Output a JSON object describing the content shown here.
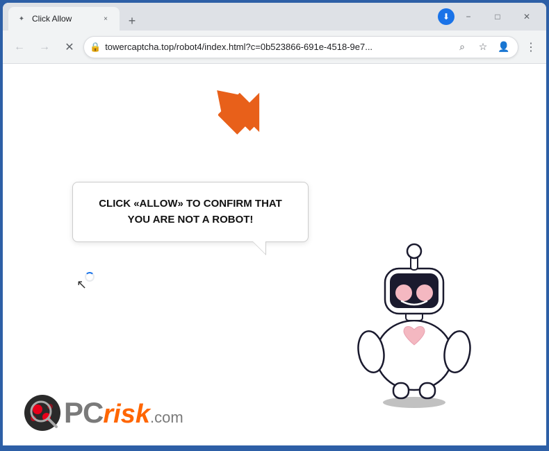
{
  "browser": {
    "title": "Click Allow",
    "url": "towercaptcha.top/robot4/index.html?c=0b523866-691e-4518-9e7...",
    "tab_title": "Click Allow",
    "new_tab_tooltip": "New tab",
    "back_tooltip": "Back",
    "forward_tooltip": "Forward",
    "reload_tooltip": "Reload",
    "window_controls": {
      "minimize": "−",
      "maximize": "□",
      "close": "✕"
    }
  },
  "page": {
    "speech_bubble_text": "CLICK «ALLOW» TO CONFIRM THAT YOU ARE NOT A ROBOT!",
    "arrow_color": "#e8601a"
  },
  "logo": {
    "pc_text": "PC",
    "risk_text": "risk",
    "com_text": ".com"
  },
  "icons": {
    "lock": "🔒",
    "search": "⌕",
    "star": "☆",
    "profile": "👤",
    "menu": "⋮",
    "back": "←",
    "forward": "→",
    "reload": "↻",
    "close_tab": "×",
    "new_tab": "+"
  }
}
